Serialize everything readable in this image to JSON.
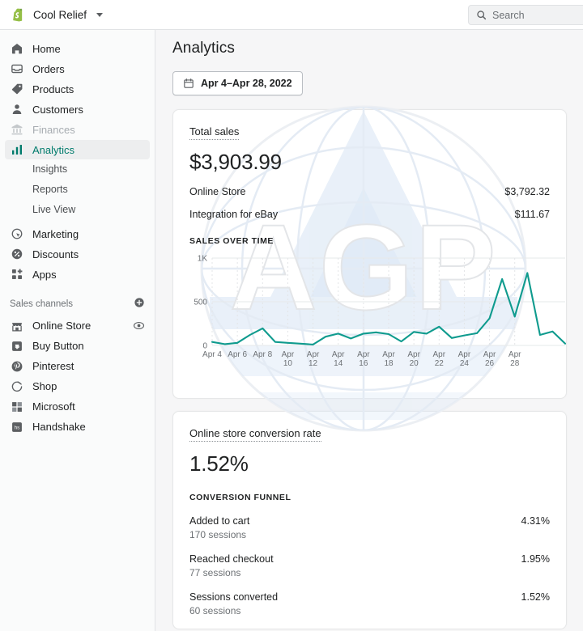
{
  "topbar": {
    "brand_name": "Cool Relief",
    "logo_icon": "shopify-bag-icon",
    "store_switcher_icon": "caret-down-icon",
    "search_icon": "search-icon",
    "search_placeholder": "Search",
    "search_value": ""
  },
  "sidebar": {
    "items": [
      {
        "label": "Home",
        "icon": "home-icon",
        "state": "default"
      },
      {
        "label": "Orders",
        "icon": "orders-icon",
        "state": "default"
      },
      {
        "label": "Products",
        "icon": "products-tag-icon",
        "state": "default"
      },
      {
        "label": "Customers",
        "icon": "customers-person-icon",
        "state": "default"
      },
      {
        "label": "Finances",
        "icon": "finances-bank-icon",
        "state": "disabled"
      },
      {
        "label": "Analytics",
        "icon": "analytics-bars-icon",
        "state": "active"
      }
    ],
    "sub_items": [
      {
        "label": "Insights"
      },
      {
        "label": "Reports"
      },
      {
        "label": "Live View"
      }
    ],
    "items2": [
      {
        "label": "Marketing",
        "icon": "marketing-target-icon"
      },
      {
        "label": "Discounts",
        "icon": "discounts-percent-icon"
      },
      {
        "label": "Apps",
        "icon": "apps-grid-icon"
      }
    ],
    "sales_channels": {
      "title": "Sales channels",
      "add_icon": "plus-circle-icon",
      "channels": [
        {
          "label": "Online Store",
          "icon": "online-store-icon",
          "trailing_icon": "eye-icon"
        },
        {
          "label": "Buy Button",
          "icon": "buy-button-icon",
          "trailing_icon": ""
        },
        {
          "label": "Pinterest",
          "icon": "pinterest-icon",
          "trailing_icon": ""
        },
        {
          "label": "Shop",
          "icon": "shop-icon",
          "trailing_icon": ""
        },
        {
          "label": "Microsoft",
          "icon": "microsoft-grid-icon",
          "trailing_icon": ""
        },
        {
          "label": "Handshake",
          "icon": "handshake-hs-icon",
          "trailing_icon": ""
        }
      ]
    }
  },
  "main": {
    "page_title": "Analytics",
    "date_range": {
      "calendar_icon": "calendar-icon",
      "label": "Apr 4–Apr 28, 2022"
    },
    "sales_card": {
      "metric_name": "Total sales",
      "metric_value": "$3,903.99",
      "breakdown": [
        {
          "label": "Online Store",
          "value": "$3,792.32"
        },
        {
          "label": "Integration for eBay",
          "value": "$111.67"
        }
      ],
      "chart_heading": "SALES OVER TIME"
    },
    "conversion_card": {
      "metric_name": "Online store conversion rate",
      "metric_value": "1.52%",
      "funnel_heading": "CONVERSION FUNNEL",
      "funnel": [
        {
          "label": "Added to cart",
          "sessions": "170 sessions",
          "pct": "4.31%"
        },
        {
          "label": "Reached checkout",
          "sessions": "77 sessions",
          "pct": "1.95%"
        },
        {
          "label": "Sessions converted",
          "sessions": "60 sessions",
          "pct": "1.52%"
        }
      ]
    }
  },
  "watermark": {
    "text": "AGP",
    "shape": "globe-watermark"
  },
  "colors": {
    "accent_teal": "#007b6c",
    "line_teal": "#0f9b8e",
    "brand_green": "#5bb130",
    "text_primary": "#202223",
    "text_subdued": "#6d7175",
    "page_bg": "#f6f6f7",
    "card_bg": "#ffffff",
    "border": "#e1e3e5"
  },
  "chart_data": {
    "type": "line",
    "title": "SALES OVER TIME",
    "xlabel": "",
    "ylabel": "",
    "ylim": [
      0,
      1000
    ],
    "yticks": [
      0,
      500,
      1000
    ],
    "ytick_labels": [
      "0",
      "500",
      "1K"
    ],
    "grid": true,
    "legend": "none",
    "x": [
      "Apr 4",
      "Apr 5",
      "Apr 6",
      "Apr 7",
      "Apr 8",
      "Apr 9",
      "Apr 10",
      "Apr 11",
      "Apr 12",
      "Apr 13",
      "Apr 14",
      "Apr 15",
      "Apr 16",
      "Apr 17",
      "Apr 18",
      "Apr 19",
      "Apr 20",
      "Apr 21",
      "Apr 22",
      "Apr 23",
      "Apr 24",
      "Apr 25",
      "Apr 26",
      "Apr 27",
      "Apr 28"
    ],
    "xtick_labels": [
      "Apr 4",
      "Apr 6",
      "Apr 8",
      "Apr 10",
      "Apr 12",
      "Apr 14",
      "Apr 16",
      "Apr 18",
      "Apr 20",
      "Apr 22",
      "Apr 24",
      "Apr 26",
      "Apr 28"
    ],
    "series": [
      {
        "name": "Total sales",
        "color": "#0f9b8e",
        "values": [
          40,
          15,
          30,
          120,
          195,
          40,
          30,
          20,
          10,
          100,
          135,
          80,
          135,
          150,
          130,
          45,
          155,
          135,
          215,
          85,
          115,
          140,
          310,
          760,
          330,
          830,
          120,
          160,
          20
        ]
      }
    ]
  }
}
